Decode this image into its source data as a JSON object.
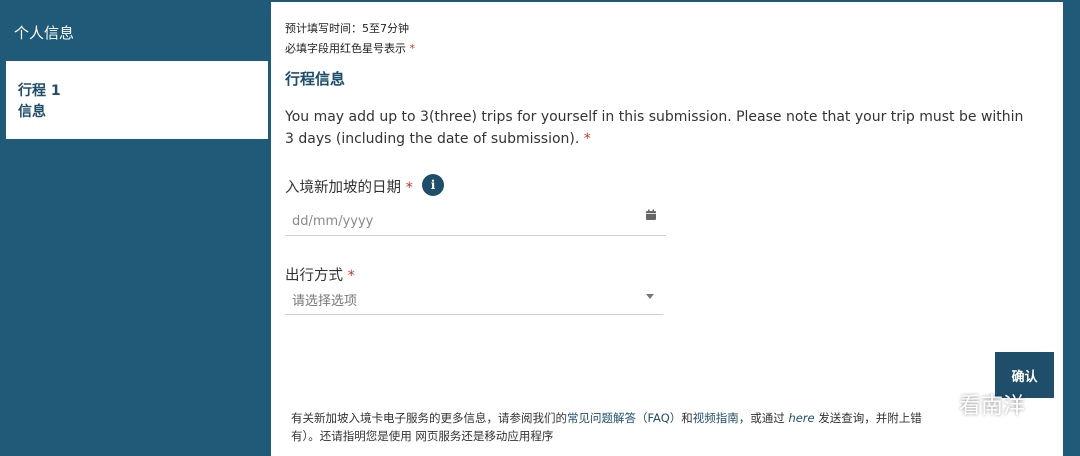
{
  "sidebar": {
    "items": [
      {
        "label": "个人信息"
      },
      {
        "label_line1": "行程 1",
        "label_line2": "信息"
      }
    ]
  },
  "form": {
    "meta_time": "预计填写时间：5至7分钟",
    "meta_required": "必填字段用红色星号表示",
    "required_mark": "*",
    "section_title": "行程信息",
    "description": "You may add up to 3(three) trips for yourself in this submission. Please note that your trip must be within 3 days (including the date of submission).",
    "date_label": "入境新加坡的日期",
    "date_placeholder": "dd/mm/yyyy",
    "info_icon_glyph": "i",
    "mode_label": "出行方式",
    "mode_placeholder": "请选择选项",
    "confirm_label": "确认"
  },
  "footer": {
    "prefix": "有关新加坡入境卡电子服务的更多信息，请参阅我们的",
    "faq_link": "常见问题解答（FAQ）",
    "and": "和",
    "video_link": "视频指南",
    "or_via": "，或通过",
    "here_link": "here",
    "send_query": "发送查询，并附上错",
    "line2": "有）。还请指明您是使用 网页服务还是移动应用程序"
  },
  "watermark": {
    "text": "看南洋"
  },
  "colors": {
    "primary": "#1f5a78",
    "heading": "#1f4e6a",
    "required": "#c0392b"
  }
}
